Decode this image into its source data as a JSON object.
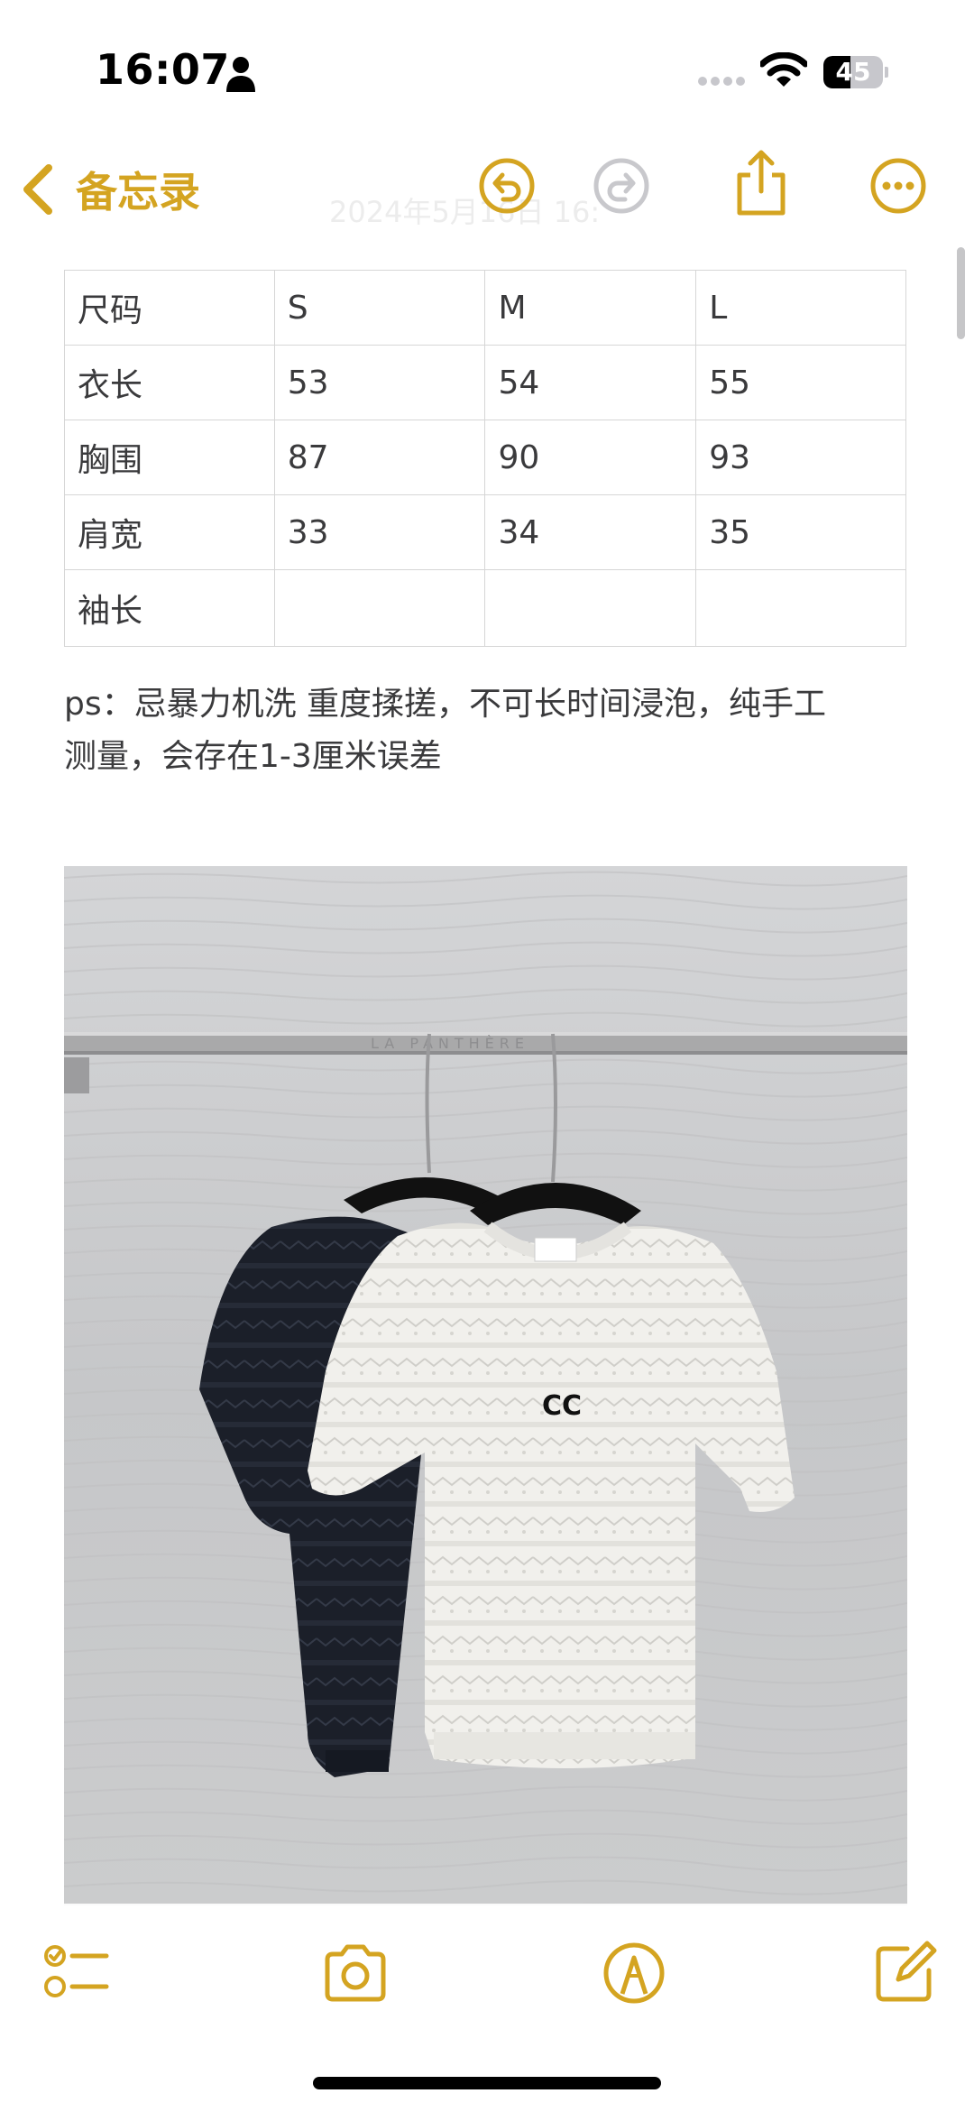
{
  "status_bar": {
    "time": "16:07",
    "battery_level": "45",
    "battery_fraction": 0.45
  },
  "nav": {
    "back_label": "备忘录",
    "date_faint": "2024年5月16日 16:"
  },
  "size_table": {
    "rows": [
      [
        "尺码",
        "S",
        "M",
        "L"
      ],
      [
        "衣长",
        "53",
        "54",
        "55"
      ],
      [
        "胸围",
        "87",
        "90",
        "93"
      ],
      [
        "肩宽",
        "33",
        "34",
        "35"
      ],
      [
        "袖长",
        "",
        "",
        ""
      ]
    ]
  },
  "note": {
    "line1": "ps：忌暴力机洗 重度揉搓，不可长时间浸泡，纯手工",
    "line2": "测量，会存在1-3厘米误差"
  },
  "photo": {
    "wall_text": "LA PANTHÈRE",
    "logo_text": "CC"
  },
  "colors": {
    "accent": "#d4a421",
    "text": "#3a3a3c",
    "border": "#d6d6d6"
  },
  "icons": {
    "nav": [
      "chevron-left-icon",
      "undo-icon",
      "redo-icon",
      "share-icon",
      "more-icon"
    ],
    "toolbar": [
      "checklist-icon",
      "camera-icon",
      "markup-icon",
      "compose-icon"
    ]
  }
}
